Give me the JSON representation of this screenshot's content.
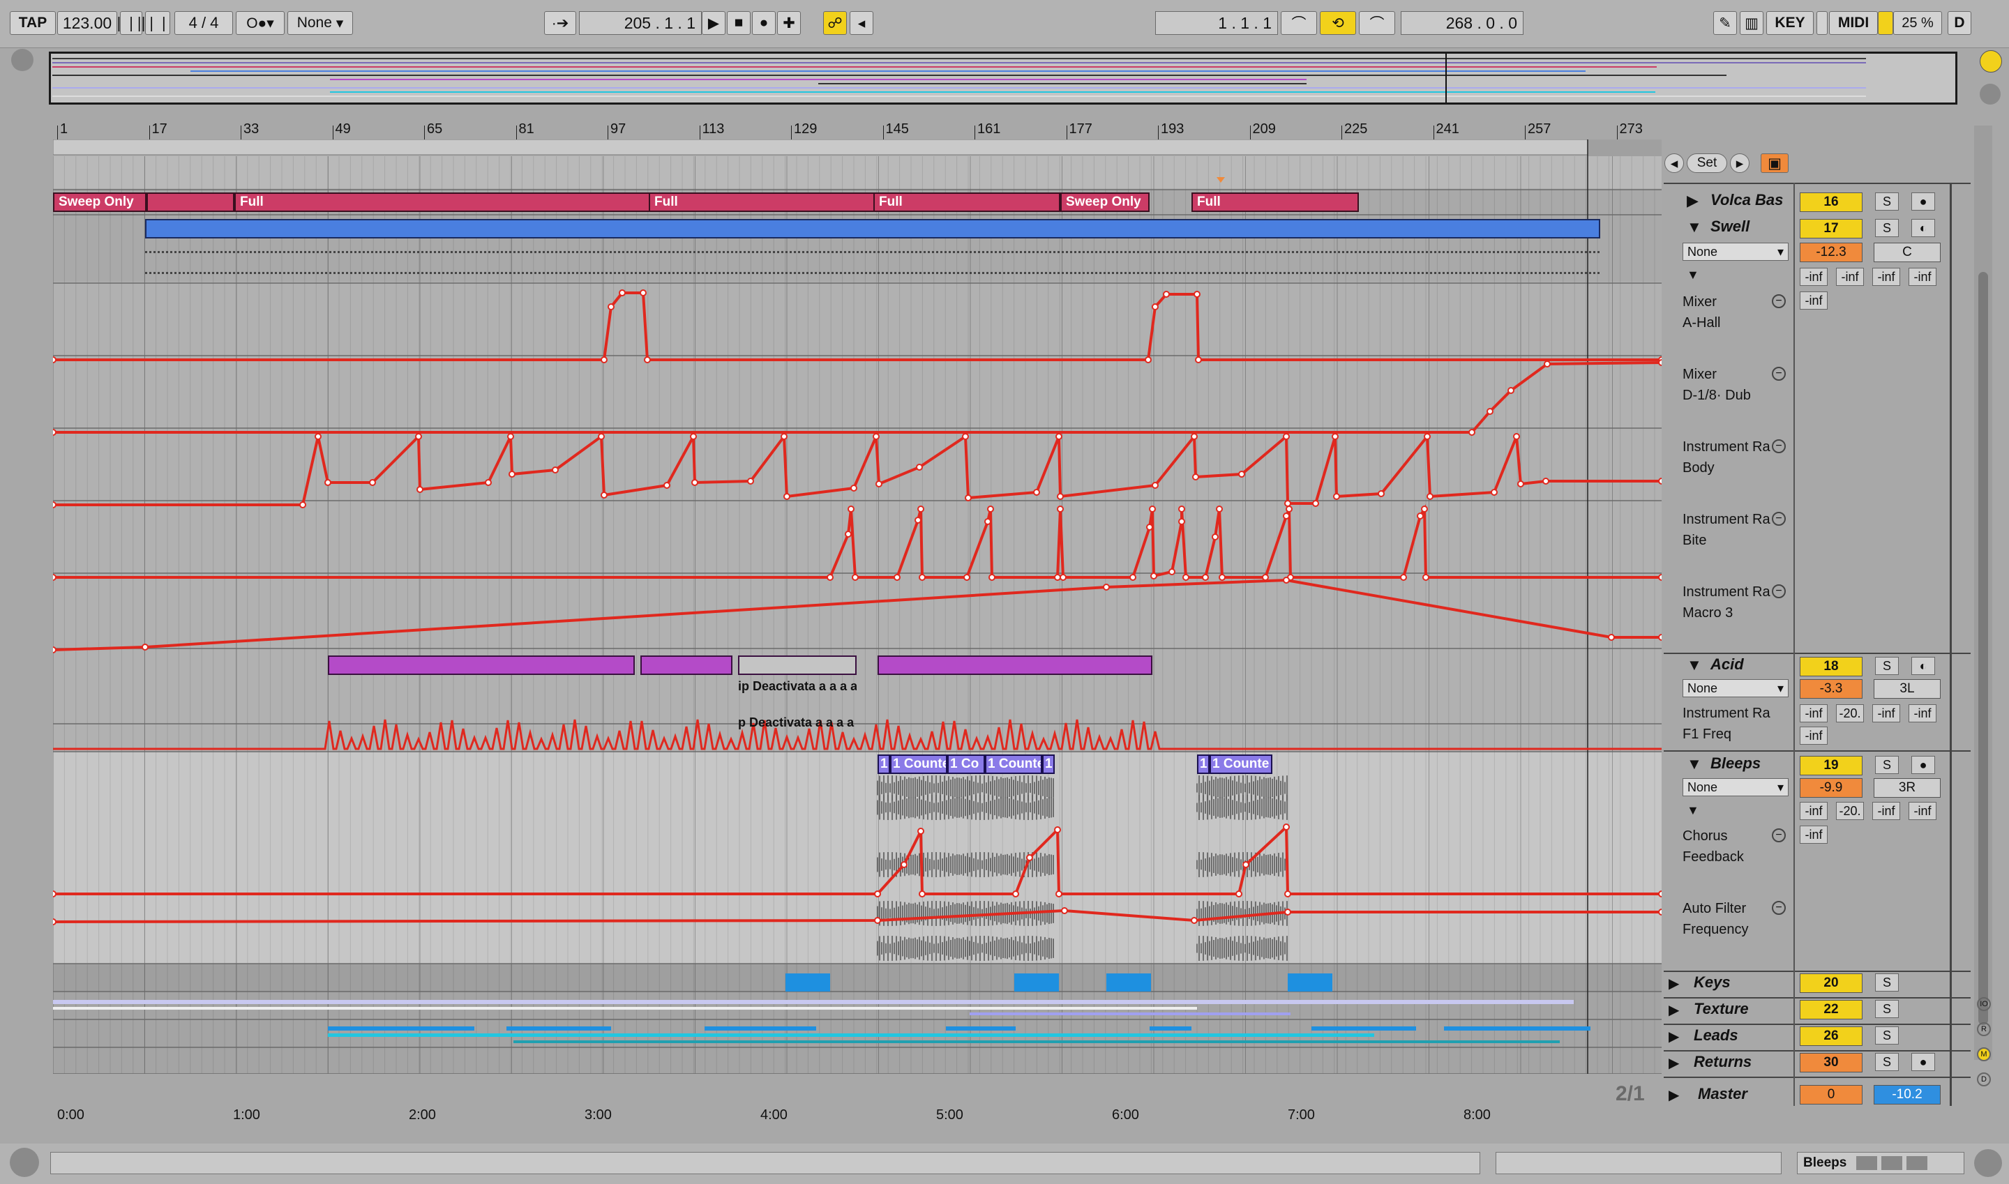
{
  "transport": {
    "tap": "TAP",
    "tempo": "123.00",
    "sig_num": "4",
    "sig_den": "4",
    "metro": "None",
    "position": "205 .   1 .   1",
    "loop_start": "1 .   1 .   1",
    "loop_length": "268 .   0 .   0",
    "key": "KEY",
    "midi": "MIDI",
    "cpu": "25 %",
    "d": "D"
  },
  "ruler": {
    "bars": [
      "1",
      "17",
      "33",
      "49",
      "65",
      "81",
      "97",
      "113",
      "129",
      "145",
      "161",
      "177",
      "193",
      "209",
      "225",
      "241",
      "257",
      "273"
    ]
  },
  "timeline": {
    "times": [
      "0:00",
      "1:00",
      "2:00",
      "3:00",
      "4:00",
      "5:00",
      "6:00",
      "7:00",
      "8:00"
    ],
    "zoom": "2/1"
  },
  "locator": {
    "set": "Set"
  },
  "scenes": [
    {
      "label": "Sweep Only"
    },
    {
      "label": "Full"
    },
    {
      "label": "Full"
    },
    {
      "label": "Full"
    },
    {
      "label": "Sweep Only"
    },
    {
      "label": "Full"
    }
  ],
  "clips": {
    "deactivate1": "ip Deactivata a a a a",
    "deactivate2": "p Deactivata a a a a",
    "count1": "1",
    "count2": "1 Counte",
    "count3": "1 Co",
    "count4": "1 Counte",
    "count5": "1",
    "count6": "1",
    "count7": "1 Counte"
  },
  "tracks": {
    "volca": {
      "name": "Volca Bas",
      "num": "16",
      "solo": "S"
    },
    "swell": {
      "name": "Swell",
      "num": "17",
      "solo": "S",
      "input": "None",
      "vol": "-12.3",
      "pan": "C",
      "sends": [
        "-inf",
        "-inf",
        "-inf",
        "-inf"
      ],
      "extra": "-inf"
    },
    "swell_lanes": [
      {
        "device": "Mixer",
        "param": "A-Hall"
      },
      {
        "device": "Mixer",
        "param": "D-1/8· Dub"
      },
      {
        "device": "Instrument Ra",
        "param": "Body"
      },
      {
        "device": "Instrument Ra",
        "param": "Bite"
      },
      {
        "device": "Instrument Ra",
        "param": "Macro 3"
      }
    ],
    "acid": {
      "name": "Acid",
      "num": "18",
      "solo": "S",
      "input": "None",
      "vol": "-3.3",
      "pan": "3L",
      "sends": [
        "-inf",
        "-20.",
        "-inf",
        "-inf"
      ],
      "extra": "-inf",
      "device": "Instrument Ra",
      "param": "F1 Freq"
    },
    "bleeps": {
      "name": "Bleeps",
      "num": "19",
      "solo": "S",
      "input": "None",
      "vol": "-9.9",
      "pan": "3R",
      "sends": [
        "-inf",
        "-20.",
        "-inf",
        "-inf"
      ],
      "extra": "-inf"
    },
    "bleeps_lanes": [
      {
        "device": "Chorus",
        "param": "Feedback"
      },
      {
        "device": "Auto Filter",
        "param": "Frequency"
      }
    ],
    "keys": {
      "name": "Keys",
      "num": "20",
      "solo": "S"
    },
    "texture": {
      "name": "Texture",
      "num": "22",
      "solo": "S"
    },
    "leads": {
      "name": "Leads",
      "num": "26",
      "solo": "S"
    },
    "returns": {
      "name": "Returns",
      "num": "30",
      "solo": "S"
    },
    "master": {
      "name": "Master",
      "vol": "0",
      "pan": "-10.2"
    }
  },
  "status": {
    "track": "Bleeps"
  },
  "colors": {
    "clip_pink": "#cc3c66",
    "clip_blue": "#4a7fe0",
    "clip_purple": "#b44bc8",
    "clip_violet": "#8a7ae8",
    "automation": "#e0281e",
    "yellow": "#f2d11b",
    "orange": "#f08a3c",
    "cyan": "#22c6e0"
  }
}
